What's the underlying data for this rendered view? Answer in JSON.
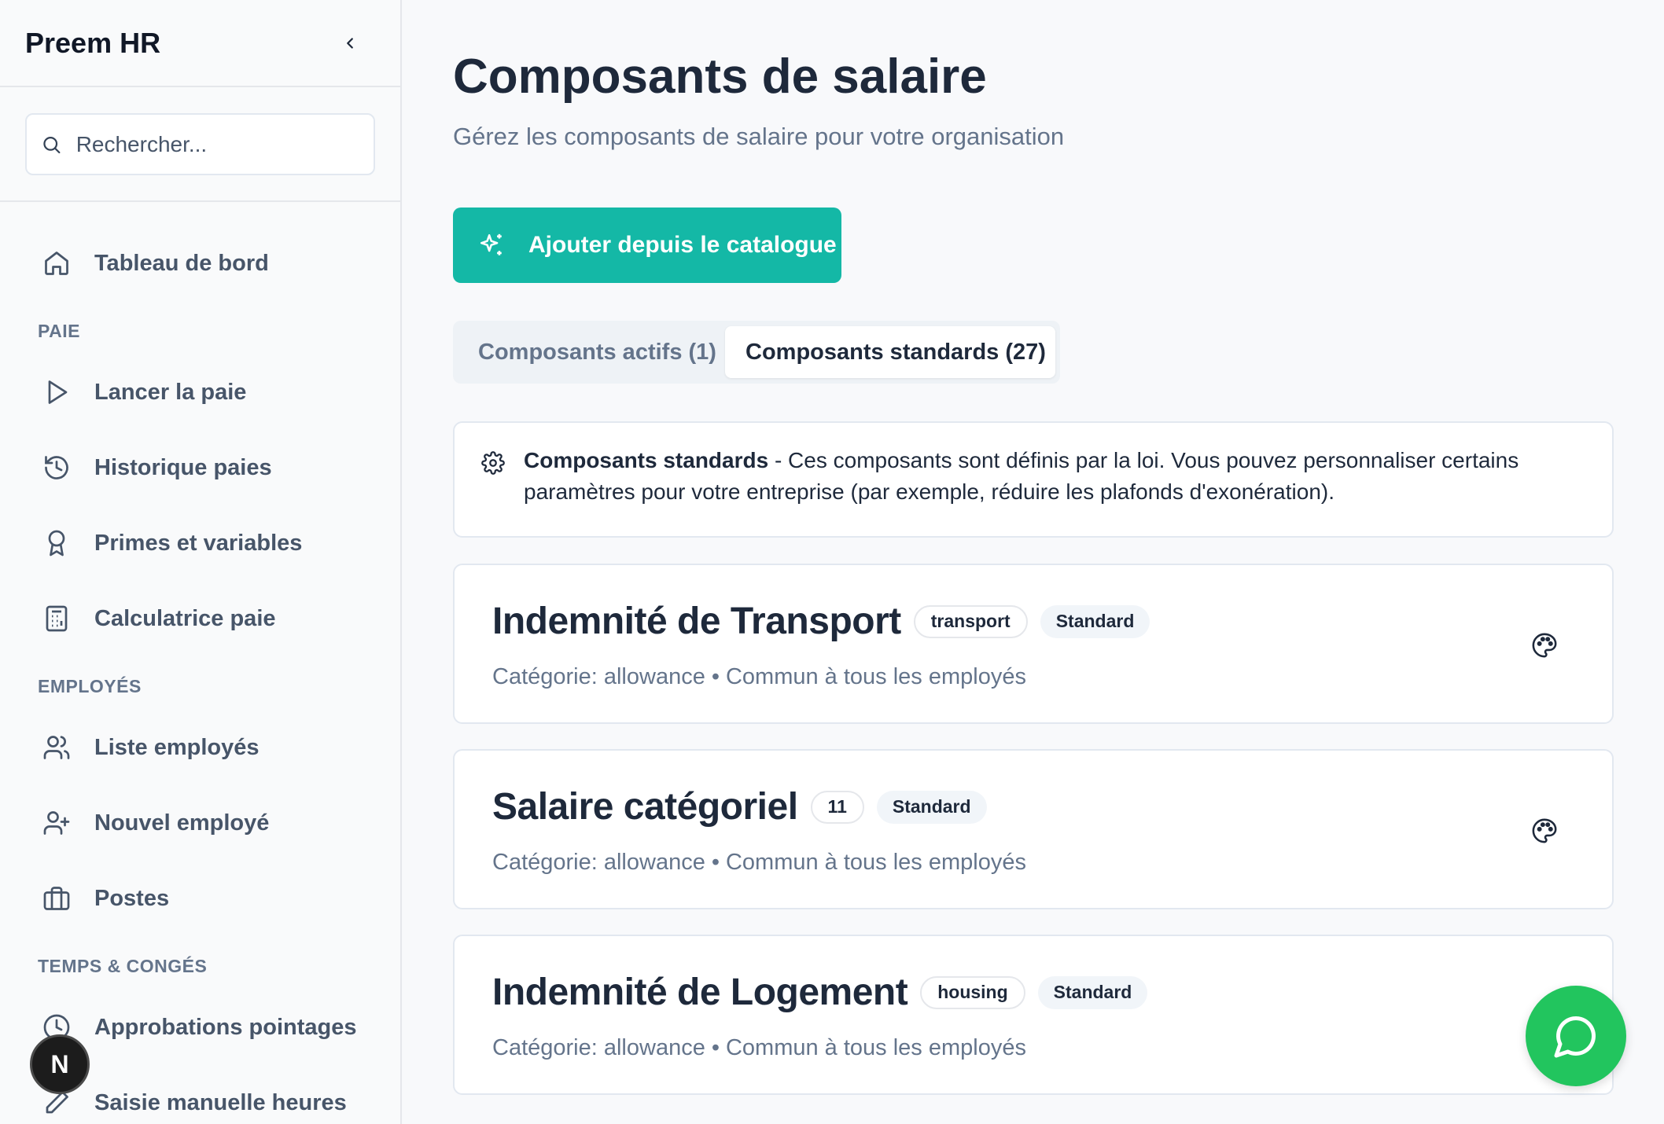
{
  "sidebar": {
    "brand": "Preem HR",
    "search_placeholder": "Rechercher...",
    "items": [
      {
        "label": "Tableau de bord",
        "icon": "home-icon"
      },
      {
        "section": "PAIE"
      },
      {
        "label": "Lancer la paie",
        "icon": "play-icon"
      },
      {
        "label": "Historique paies",
        "icon": "history-icon"
      },
      {
        "label": "Primes et variables",
        "icon": "award-icon"
      },
      {
        "label": "Calculatrice paie",
        "icon": "calculator-icon"
      },
      {
        "section": "EMPLOYÉS"
      },
      {
        "label": "Liste employés",
        "icon": "users-icon"
      },
      {
        "label": "Nouvel employé",
        "icon": "user-plus-icon"
      },
      {
        "label": "Postes",
        "icon": "briefcase-icon"
      },
      {
        "section": "TEMPS & CONGÉS"
      },
      {
        "label": "Approbations pointages",
        "icon": "clock-icon"
      },
      {
        "label": "Saisie manuelle heures",
        "icon": "pencil-icon"
      }
    ],
    "next_badge": "N"
  },
  "main": {
    "title": "Composants de salaire",
    "subtitle": "Gérez les composants de salaire pour votre organisation",
    "add_button": "Ajouter depuis le catalogue",
    "tabs": [
      {
        "label": "Composants actifs (1)",
        "active": false
      },
      {
        "label": "Composants standards (27)",
        "active": true
      }
    ],
    "info": {
      "bold": "Composants standards",
      "text": " - Ces composants sont définis par la loi. Vous pouvez personnaliser certains paramètres pour votre entreprise (par exemple, réduire les plafonds d'exonération)."
    },
    "cards": [
      {
        "title": "Indemnité de Transport",
        "code": "transport",
        "badge": "Standard",
        "category": "Catégorie: allowance",
        "scope": "Commun à tous les employés"
      },
      {
        "title": "Salaire catégoriel",
        "code": "11",
        "badge": "Standard",
        "category": "Catégorie: allowance",
        "scope": "Commun à tous les employés"
      },
      {
        "title": "Indemnité de Logement",
        "code": "housing",
        "badge": "Standard",
        "category": "Catégorie: allowance",
        "scope": "Commun à tous les employés"
      }
    ],
    "meta_separator": "•"
  },
  "colors": {
    "accent": "#14b8a6",
    "chat": "#22c55e",
    "text": "#1e293b",
    "muted": "#64748b"
  }
}
